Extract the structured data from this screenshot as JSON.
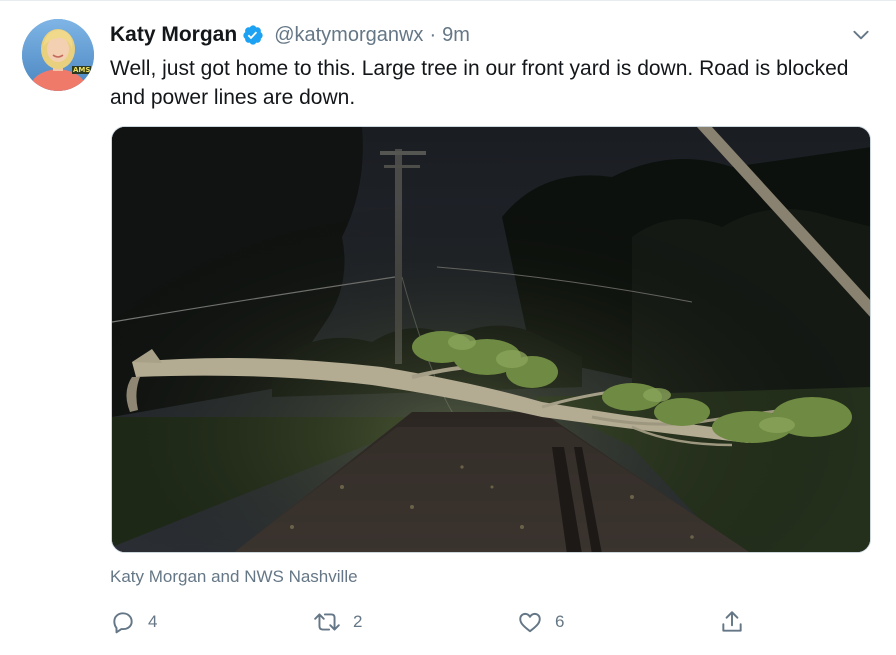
{
  "tweet": {
    "display_name": "Katy Morgan",
    "handle": "@katymorganwx",
    "separator": "·",
    "time": "9m",
    "text": "Well, just got home to this.  Large tree in our front yard is down.  Road is blocked and power lines are down.",
    "tagged_users": "Katy Morgan and NWS Nashville",
    "image_alt": "Fallen tree and downed power lines blocking a road at night",
    "avatar_badge": "AMS"
  },
  "actions": {
    "reply_count": "4",
    "retweet_count": "2",
    "like_count": "6"
  },
  "icons": {
    "verified": "verified-badge-icon",
    "more": "chevron-down-icon",
    "reply": "reply-icon",
    "retweet": "retweet-icon",
    "like": "heart-icon",
    "share": "share-icon"
  },
  "colors": {
    "verified_blue": "#1da1f2",
    "secondary_text": "#657786",
    "primary_text": "#14171a"
  }
}
